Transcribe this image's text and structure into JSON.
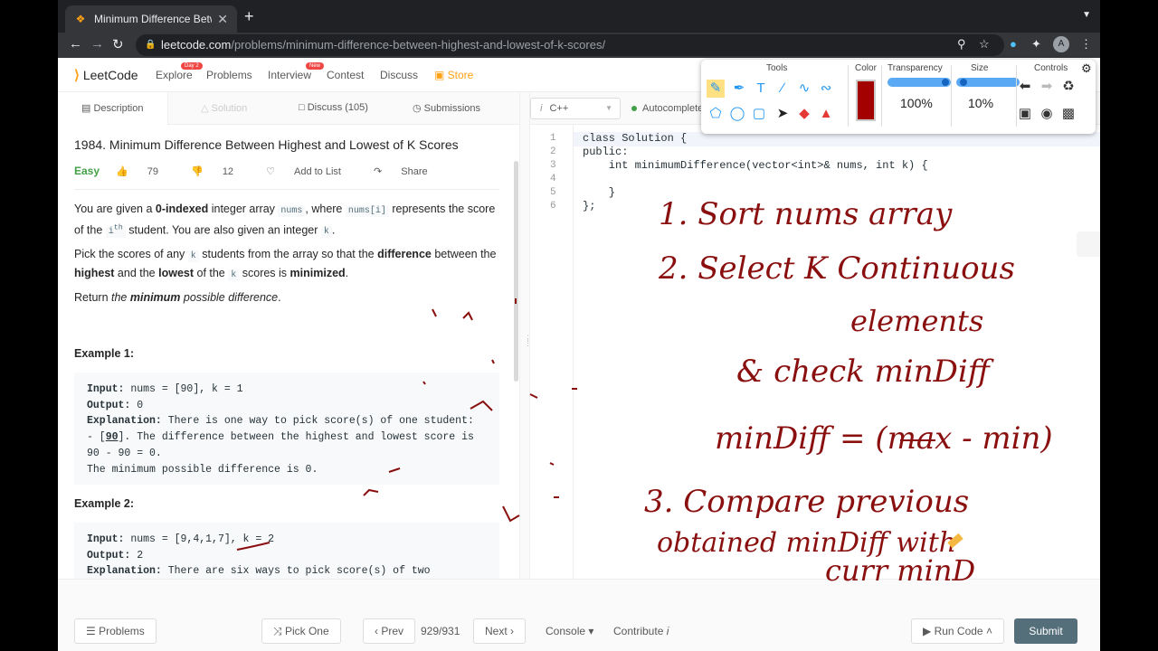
{
  "browser": {
    "tab_title": "Minimum Difference Between H",
    "url_host": "leetcode.com",
    "url_path": "/problems/minimum-difference-between-highest-and-lowest-of-k-scores/",
    "avatar_letter": "A"
  },
  "header": {
    "logo": "LeetCode",
    "nav": [
      "Explore",
      "Problems",
      "Interview",
      "Contest",
      "Discuss",
      "Store"
    ],
    "badge_explore": "Day 2",
    "badge_interview": "New"
  },
  "left_tabs": {
    "description": "Description",
    "solution": "Solution",
    "discuss": "Discuss (105)",
    "submissions": "Submissions"
  },
  "problem": {
    "title": "1984. Minimum Difference Between Highest and Lowest of K Scores",
    "difficulty": "Easy",
    "likes": "79",
    "dislikes": "12",
    "add_to_list": "Add to List",
    "share": "Share"
  },
  "example1": {
    "heading": "Example 1:"
  },
  "example2": {
    "heading": "Example 2:"
  },
  "editor": {
    "language": "C++",
    "autocomplete": "Autocomplete",
    "line_numbers": [
      "1",
      "2",
      "3",
      "4",
      "5",
      "6"
    ],
    "lines": [
      "class Solution {",
      "public:",
      "    int minimumDifference(vector<int>& nums, int k) {",
      "",
      "    }",
      "};"
    ]
  },
  "footer": {
    "problems": "Problems",
    "pick_one": "Pick One",
    "prev": "Prev",
    "page": "929/931",
    "next": "Next",
    "console": "Console",
    "contribute": "Contribute",
    "run_code": "Run Code",
    "submit": "Submit"
  },
  "toolbar": {
    "tools": "Tools",
    "color": "Color",
    "transparency": "Transparency",
    "size": "Size",
    "controls": "Controls",
    "transparency_value": "100%",
    "size_value": "10%",
    "pen_color": "#a30000"
  },
  "handwriting": {
    "line1": "1. Sort nums array",
    "line2": "2. Select K Continuous",
    "line3": "elements",
    "line4": "& check minDiff",
    "line5": "minDiff = (max - min)",
    "line6": "3. Compare previous",
    "line7": "obtained minDiff with",
    "line8": "curr minD"
  }
}
